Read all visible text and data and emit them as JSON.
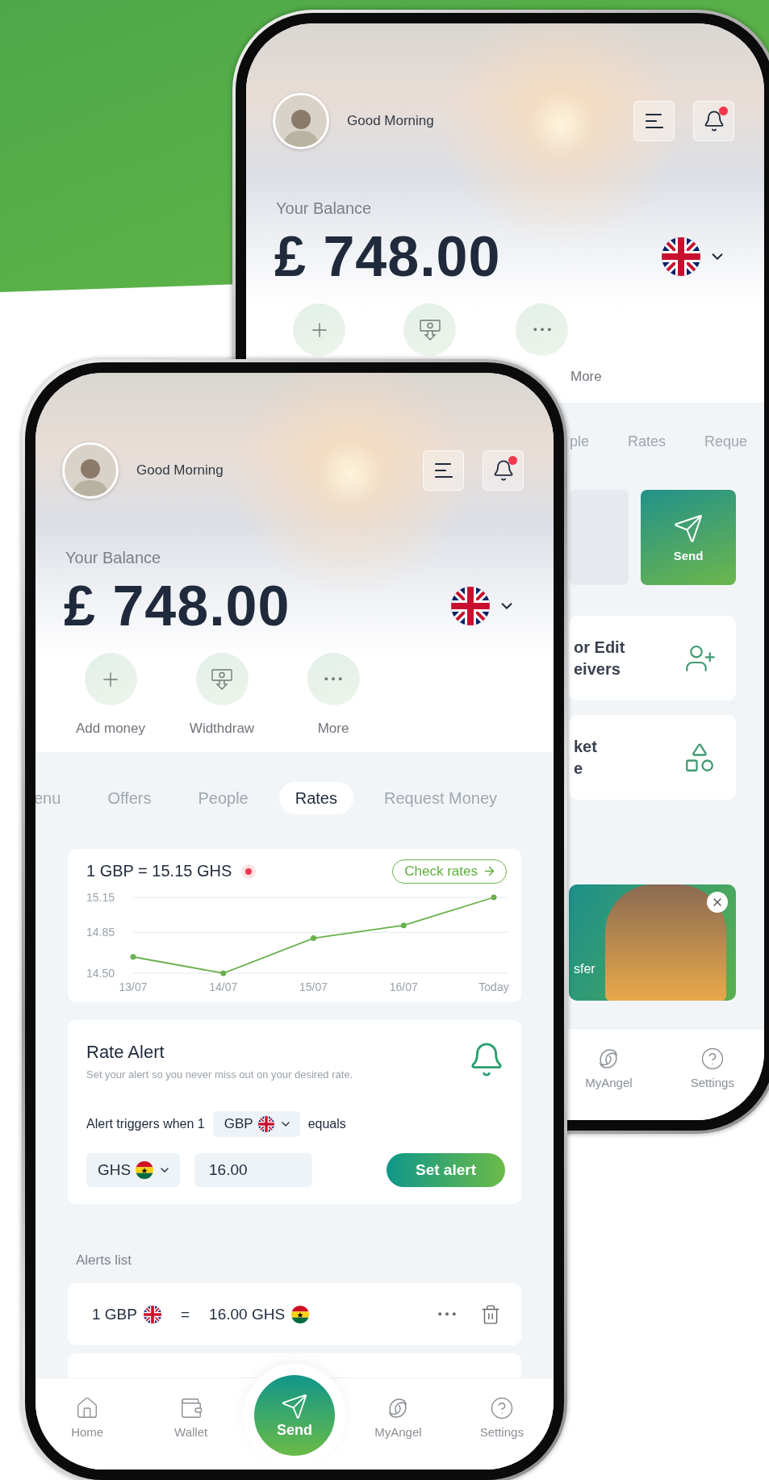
{
  "back_phone": {
    "greeting": "Good Morning",
    "has_unread": true,
    "balance_label": "Your Balance",
    "balance": "£ 748.00",
    "currency": {
      "kind": "uk"
    },
    "actions": [
      {
        "kind": "add"
      },
      {
        "kind": "withdraw"
      },
      {
        "kind": "more",
        "label": "More"
      }
    ],
    "tabs": [
      {
        "label": "ple",
        "selected": false
      },
      {
        "label": "Rates",
        "selected": false
      },
      {
        "label": "Reque",
        "selected": false
      }
    ],
    "send_tile": {
      "label": "Send"
    },
    "cards": [
      {
        "kind": "receivers",
        "title": "or Edit\neivers"
      },
      {
        "kind": "market",
        "title": "ket\ne"
      }
    ],
    "promo": {
      "text": "sfer"
    },
    "nav": [
      {
        "kind": "angel",
        "label": "MyAngel"
      },
      {
        "kind": "settings",
        "label": "Settings"
      }
    ]
  },
  "front_phone": {
    "greeting": "Good Morning",
    "has_unread": true,
    "balance_label": "Your Balance",
    "balance": "£ 748.00",
    "currency": {
      "kind": "uk"
    },
    "actions": [
      {
        "kind": "add",
        "label": "Add money"
      },
      {
        "kind": "withdraw",
        "label": "Widthdraw"
      },
      {
        "kind": "more",
        "label": "More"
      }
    ],
    "tabs": [
      {
        "label": "enu",
        "selected": false
      },
      {
        "label": "Offers",
        "selected": false
      },
      {
        "label": "People",
        "selected": false
      },
      {
        "label": "Rates",
        "selected": true
      },
      {
        "label": "Request Money",
        "selected": false
      }
    ],
    "rate_card": {
      "title": "1 GBP = 15.15 GHS",
      "live": true,
      "link": "Check rates",
      "chart_data": {
        "type": "line",
        "categories": [
          "13/07",
          "14/07",
          "15/07",
          "16/07",
          "Today"
        ],
        "series": [
          {
            "color": "#6ab04c",
            "marker": true,
            "values": [
              14.64,
              14.5,
              14.8,
              14.91,
              15.15
            ]
          }
        ],
        "ylim": [
          14.5,
          15.15
        ],
        "yticks": [
          {
            "value": 14.5,
            "label": "14.50"
          },
          {
            "value": 14.85,
            "label": "14.85"
          },
          {
            "value": 15.15,
            "label": "15.15"
          }
        ]
      }
    },
    "rate_alert": {
      "title": "Rate Alert",
      "subtitle": "Set your alert so you never miss out on your desired rate.",
      "trigger_prefix": "Alert triggers when 1",
      "from_currency": {
        "code": "GBP",
        "kind": "uk"
      },
      "trigger_suffix": "equals",
      "to_currency": {
        "code": "GHS",
        "kind": "gh"
      },
      "amount": "16.00",
      "button": "Set alert"
    },
    "alerts_heading": "Alerts list",
    "alerts": [
      {
        "from": {
          "text": "1 GBP",
          "kind": "uk"
        },
        "equals": "=",
        "to": {
          "text": "16.00 GHS",
          "kind": "gh"
        }
      }
    ],
    "nav": [
      {
        "kind": "home",
        "label": "Home"
      },
      {
        "kind": "wallet",
        "label": "Wallet"
      },
      {
        "kind": "send",
        "label": "Send"
      },
      {
        "kind": "angel",
        "label": "MyAngel"
      },
      {
        "kind": "settings",
        "label": "Settings"
      }
    ]
  }
}
